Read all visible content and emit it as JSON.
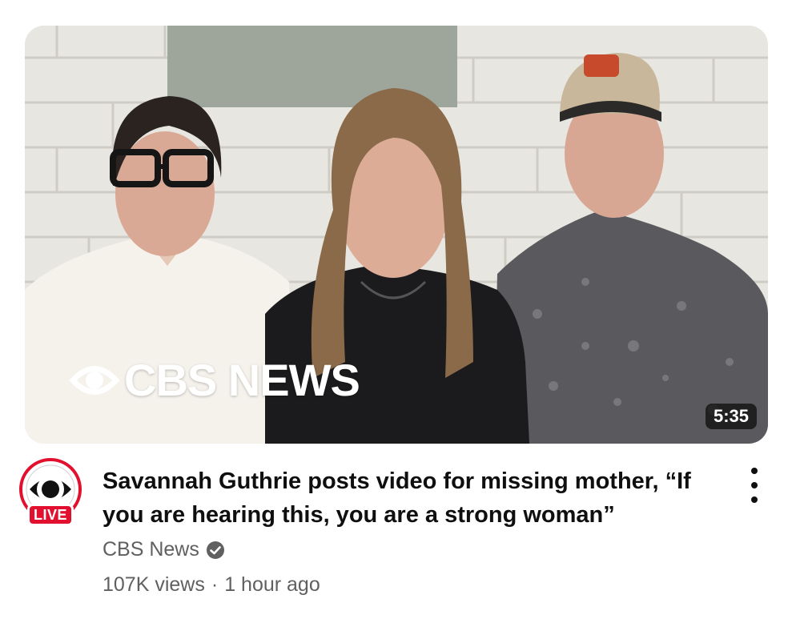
{
  "thumbnail": {
    "watermark": "CBS NEWS",
    "duration": "5:35"
  },
  "channel": {
    "name": "CBS News",
    "live_badge": "LIVE",
    "verified": true
  },
  "video": {
    "title": "Savannah Guthrie posts video for missing mother, “If you are hearing this, you are a strong woman”",
    "views": "107K views",
    "separator": "·",
    "age": "1 hour ago"
  },
  "icons": {
    "avatar": "cbs-eye-logo-icon",
    "verified": "verified-check-icon",
    "menu": "more-vert-icon",
    "watermark_logo": "cbs-eye-icon"
  },
  "colors": {
    "live_red": "#e2102e",
    "text_primary": "#0f0f0f",
    "text_secondary": "#606060"
  }
}
